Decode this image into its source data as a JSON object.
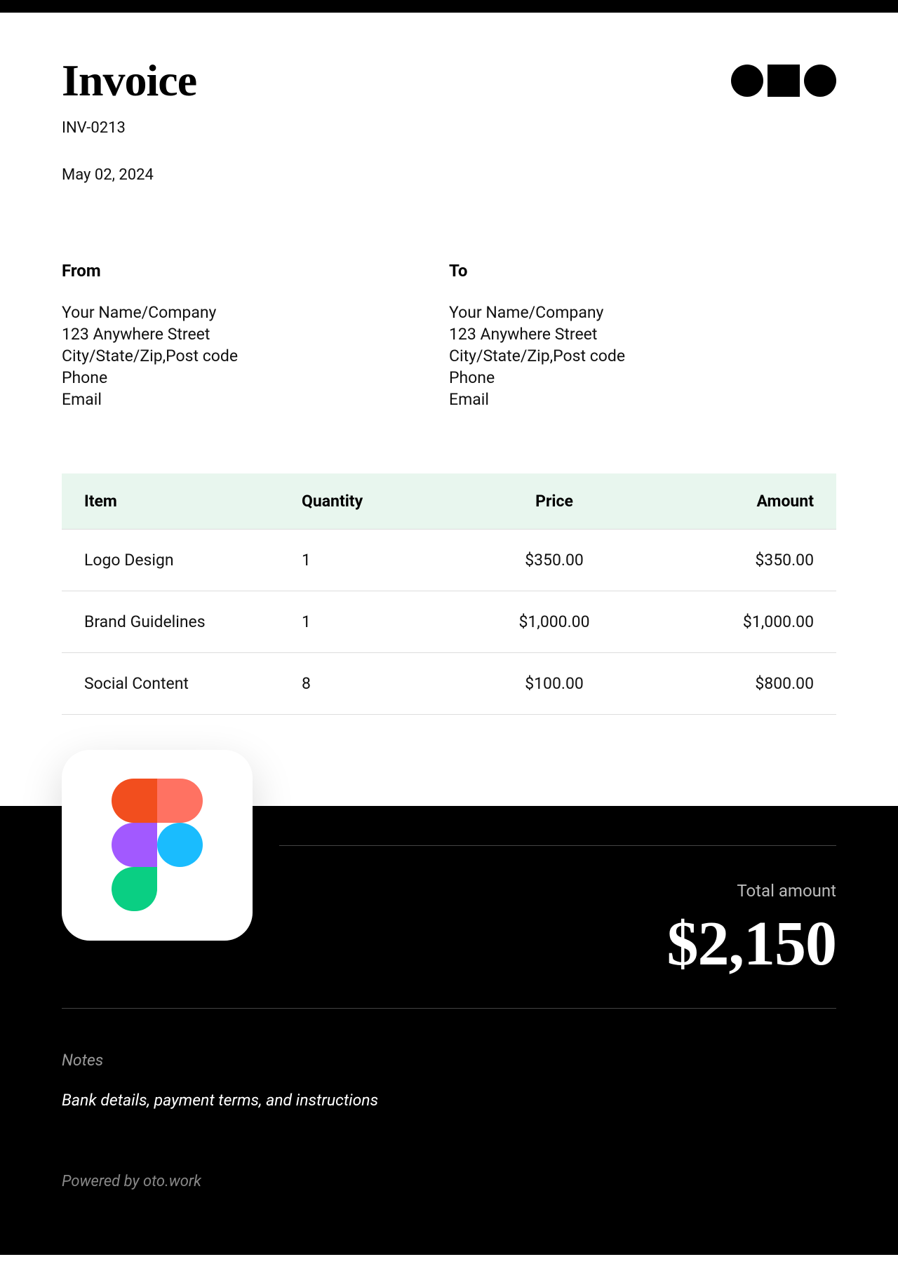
{
  "header": {
    "title": "Invoice",
    "invoice_number": "INV-0213",
    "date": "May 02, 2024"
  },
  "from": {
    "label": "From",
    "name": "Your Name/Company",
    "address": "123 Anywhere Street",
    "city": "City/State/Zip,Post code",
    "phone": "Phone",
    "email": "Email"
  },
  "to": {
    "label": "To",
    "name": "Your Name/Company",
    "address": "123 Anywhere Street",
    "city": "City/State/Zip,Post code",
    "phone": "Phone",
    "email": "Email"
  },
  "table": {
    "headers": {
      "item": "Item",
      "quantity": "Quantity",
      "price": "Price",
      "amount": "Amount"
    },
    "rows": [
      {
        "item": "Logo Design",
        "quantity": "1",
        "price": "$350.00",
        "amount": "$350.00"
      },
      {
        "item": "Brand Guidelines",
        "quantity": "1",
        "price": "$1,000.00",
        "amount": "$1,000.00"
      },
      {
        "item": "Social Content",
        "quantity": "8",
        "price": "$100.00",
        "amount": "$800.00"
      }
    ]
  },
  "total": {
    "label": "Total amount",
    "value": "$2,150"
  },
  "notes": {
    "label": "Notes",
    "text": "Bank details, payment terms, and instructions"
  },
  "footer": {
    "powered": "Powered by oto.work"
  }
}
